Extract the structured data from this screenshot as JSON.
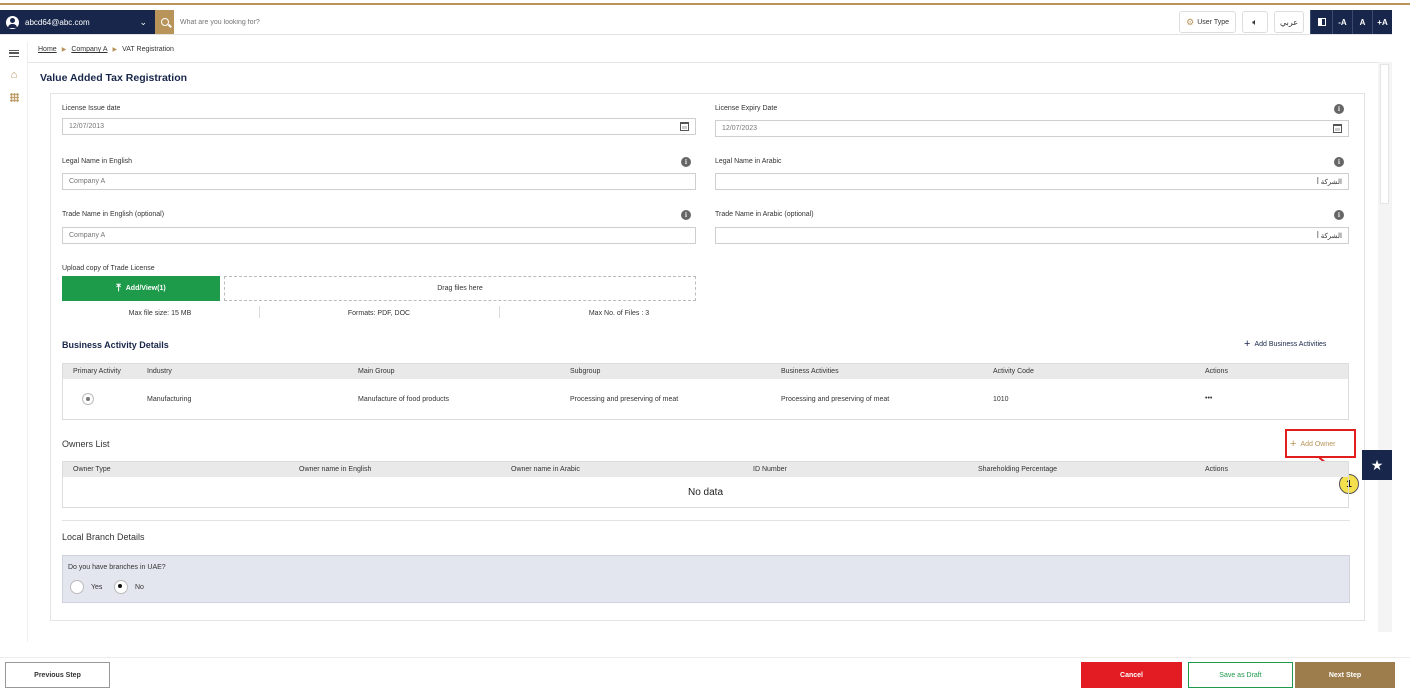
{
  "header": {
    "user_email": "abcd64@abc.com",
    "search_placeholder": "What are you looking for?",
    "user_type_label": "User Type",
    "language_label": "عربي",
    "font_decrease": "-A",
    "font_normal": "A",
    "font_increase": "+A"
  },
  "breadcrumb": {
    "home": "Home",
    "company": "Company A",
    "current": "VAT Registration"
  },
  "page_title": "Value Added Tax Registration",
  "form": {
    "license_issue_label": "License Issue date",
    "license_issue_value": "12/07/2013",
    "license_expiry_label": "License Expiry Date",
    "license_expiry_value": "12/07/2023",
    "legal_name_en_label": "Legal Name in English",
    "legal_name_en_placeholder": "Company A",
    "legal_name_ar_label": "Legal Name in Arabic",
    "legal_name_ar_value": "الشركة أ",
    "trade_name_en_label": "Trade Name in English (optional)",
    "trade_name_en_placeholder": "Company A",
    "trade_name_ar_label": "Trade Name in Arabic (optional)",
    "trade_name_ar_value": "الشركة أ"
  },
  "upload": {
    "label": "Upload copy of Trade License",
    "button": "Add/View(1)",
    "dropzone": "Drag files here",
    "max_size": "Max file size: 15 MB",
    "formats": "Formats: PDF, DOC",
    "max_files": "Max No. of Files : 3"
  },
  "business": {
    "title": "Business Activity Details",
    "add_label": "Add Business Activities",
    "columns": [
      "Primary Activity",
      "Industry",
      "Main Group",
      "Subgroup",
      "Business Activities",
      "Activity Code",
      "Actions"
    ],
    "row": {
      "industry": "Manufacturing",
      "main_group": "Manufacture of food products",
      "subgroup": "Processing and preserving of meat",
      "activities": "Processing and preserving of meat",
      "code": "1010",
      "actions": "•••"
    }
  },
  "owners": {
    "title": "Owners List",
    "add_label": "Add Owner",
    "columns": [
      "Owner Type",
      "Owner name in English",
      "Owner name in Arabic",
      "ID Number",
      "Shareholding Percentage",
      "Actions"
    ],
    "empty": "No data"
  },
  "callout_number": "1",
  "branch": {
    "title": "Local Branch Details",
    "question": "Do you have branches in UAE?",
    "yes": "Yes",
    "no": "No",
    "selected": "No"
  },
  "footer": {
    "previous": "Previous Step",
    "cancel": "Cancel",
    "draft": "Save as Draft",
    "next": "Next Step"
  },
  "colors": {
    "navy": "#17264a",
    "gold": "#b8945a",
    "green": "#1e9a4b",
    "red": "#e31b23",
    "next_brown": "#9d7d4c"
  },
  "icons": [
    "user-icon",
    "chevron-down-icon",
    "search-icon",
    "gear-icon",
    "speaker-icon",
    "contrast-icon",
    "menu-icon",
    "home-icon",
    "grid-icon",
    "calendar-icon",
    "info-icon",
    "upload-icon",
    "plus-icon",
    "star-icon"
  ]
}
